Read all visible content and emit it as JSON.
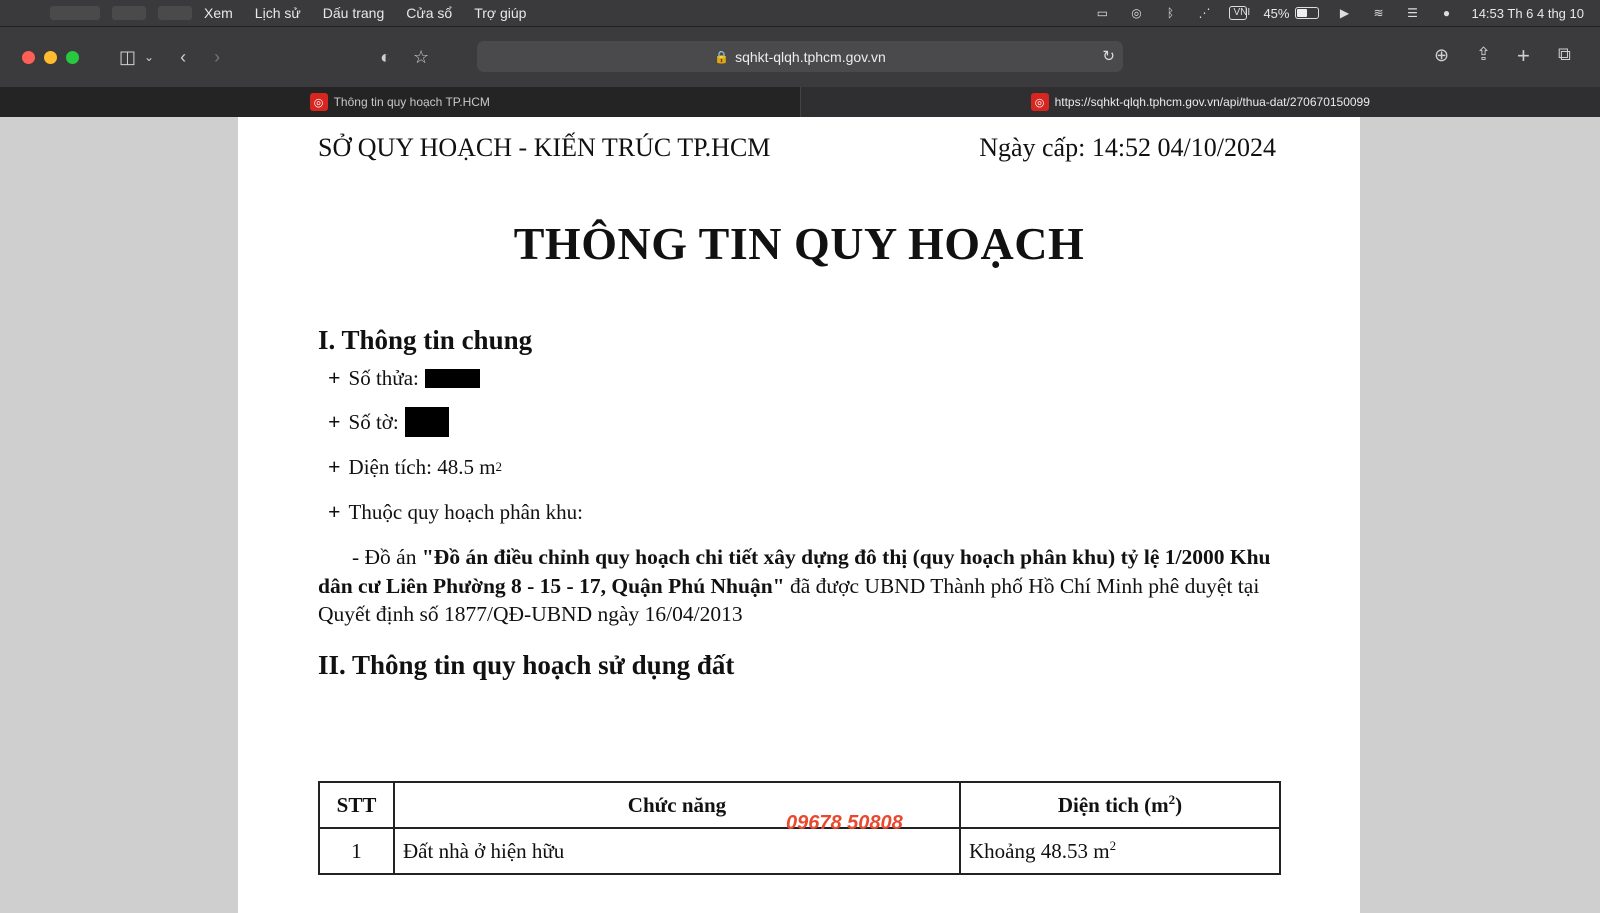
{
  "menubar": {
    "items": [
      "Xem",
      "Lịch sử",
      "Dấu trang",
      "Cửa sổ",
      "Trợ giúp"
    ],
    "input_method": "VNI",
    "battery_percent": "45%",
    "battery_level": 0.45,
    "clock": "14:53 Th 6 4 thg 10"
  },
  "toolbar": {
    "url": "sqhkt-qlqh.tphcm.gov.vn"
  },
  "tabs": [
    {
      "title": "Thông tin quy hoạch TP.HCM",
      "active": false
    },
    {
      "title": "https://sqhkt-qlqh.tphcm.gov.vn/api/thua-dat/270670150099",
      "active": true
    }
  ],
  "document": {
    "agency": "SỞ QUY HOẠCH - KIẾN TRÚC TP.HCM",
    "issue_date": "Ngày cấp: 14:52 04/10/2024",
    "title": "THÔNG TIN QUY HOẠCH",
    "section1": {
      "heading": "I. Thông tin chung",
      "plot_label": "Số thửa:",
      "sheet_label": "Số tờ:",
      "area_label": "Diện tích: 48.5 m",
      "area_sup": "2",
      "zone_label": "Thuộc quy hoạch phân khu:",
      "project_prefix": "- Đồ án ",
      "project_name": "\"Đồ án điều chỉnh quy hoạch chi tiết xây dựng đô thị (quy hoạch phân khu) tỷ lệ 1/2000 Khu dân cư Liên Phường 8 - 15 - 17, Quận Phú Nhuận\"",
      "project_suffix": " đã được UBND Thành phố Hồ Chí Minh phê duyệt tại Quyết định số 1877/QĐ-UBND ngày 16/04/2013"
    },
    "section2": {
      "heading": "II. Thông tin quy hoạch sử dụng đất",
      "table": {
        "col_stt": "STT",
        "col_function": "Chức năng",
        "col_area": "Diện tich (m",
        "col_area_sup": "2",
        "col_area_end": ")",
        "rows": [
          {
            "stt": "1",
            "function": "Đất nhà ở hiện hữu",
            "area": "Khoảng 48.53 m",
            "area_sup": "2"
          }
        ]
      }
    },
    "watermark": "09678 50808"
  },
  "plus_symbol": "+"
}
